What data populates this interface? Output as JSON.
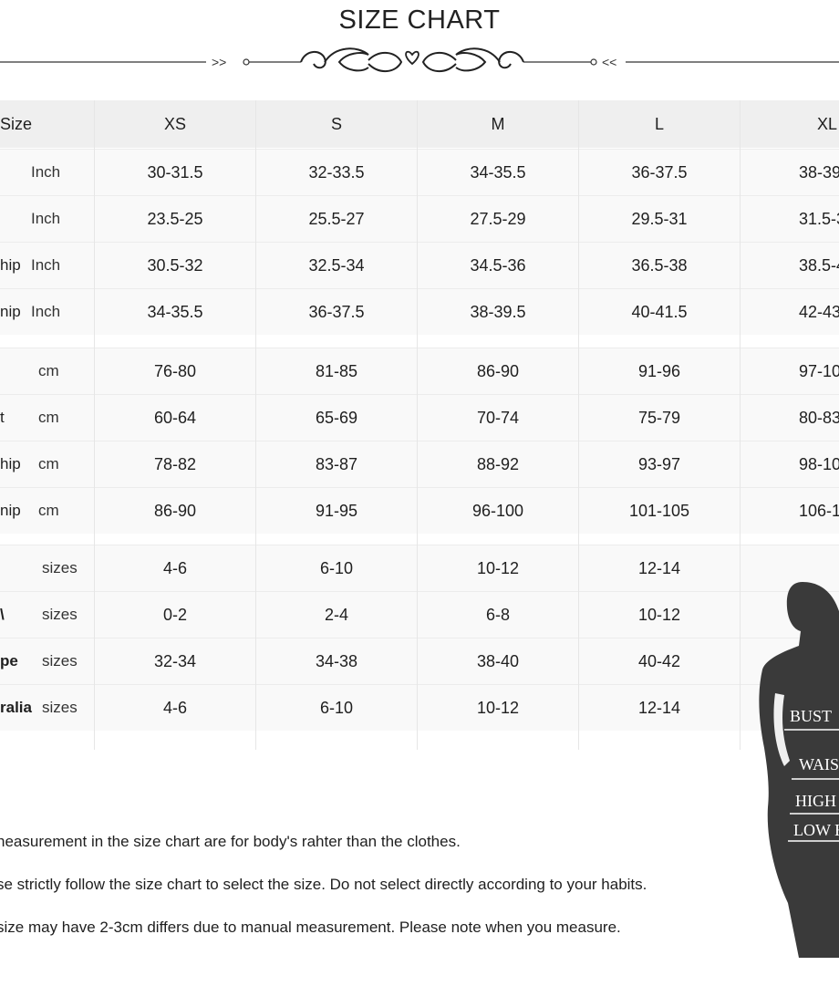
{
  "title": "SIZE CHART",
  "divider": {
    "left_arrows": ">>",
    "right_arrows": "<<"
  },
  "table": {
    "header": {
      "label": "Size",
      "sizes": [
        "XS",
        "S",
        "M",
        "L",
        "XL"
      ]
    },
    "inch_rows": [
      {
        "label": "",
        "unit": "Inch",
        "values": [
          "30-31.5",
          "32-33.5",
          "34-35.5",
          "36-37.5",
          "38-39"
        ]
      },
      {
        "label": "",
        "unit": "Inch",
        "values": [
          "23.5-25",
          "25.5-27",
          "27.5-29",
          "29.5-31",
          "31.5-3"
        ]
      },
      {
        "label": "hip",
        "unit": "Inch",
        "values": [
          "30.5-32",
          "32.5-34",
          "34.5-36",
          "36.5-38",
          "38.5-4"
        ]
      },
      {
        "label": "nip",
        "unit": "Inch",
        "values": [
          "34-35.5",
          "36-37.5",
          "38-39.5",
          "40-41.5",
          "42-43"
        ]
      }
    ],
    "cm_rows": [
      {
        "label": "",
        "unit": "cm",
        "values": [
          "76-80",
          "81-85",
          "86-90",
          "91-96",
          "97-10"
        ]
      },
      {
        "label": "t",
        "unit": "cm",
        "values": [
          "60-64",
          "65-69",
          "70-74",
          "75-79",
          "80-83"
        ]
      },
      {
        "label": "hip",
        "unit": "cm",
        "values": [
          "78-82",
          "83-87",
          "88-92",
          "93-97",
          "98-10"
        ]
      },
      {
        "label": "nip",
        "unit": "cm",
        "values": [
          "86-90",
          "91-95",
          "96-100",
          "101-105",
          "106-1"
        ]
      }
    ],
    "region_rows": [
      {
        "label": "",
        "unit": "sizes",
        "values": [
          "4-6",
          "6-10",
          "10-12",
          "12-14",
          ""
        ]
      },
      {
        "label": "\\",
        "unit": "sizes",
        "values": [
          "0-2",
          "2-4",
          "6-8",
          "10-12",
          ""
        ]
      },
      {
        "label": "pe",
        "unit": "sizes",
        "values": [
          "32-34",
          "34-38",
          "38-40",
          "40-42",
          ""
        ]
      },
      {
        "label": "ralia",
        "unit": "sizes",
        "values": [
          "4-6",
          "6-10",
          "10-12",
          "12-14",
          ""
        ]
      }
    ]
  },
  "notes": [
    "neasurement in the size chart are for body's rahter than the clothes.",
    "se strictly follow the size chart  to select the size. Do not select directly according to your habits.",
    "size may have 2-3cm differs due to manual measurement. Please note when you measure."
  ],
  "figure": {
    "labels": [
      "BUST",
      "WAIS",
      "HIGH",
      "LOW H"
    ]
  }
}
